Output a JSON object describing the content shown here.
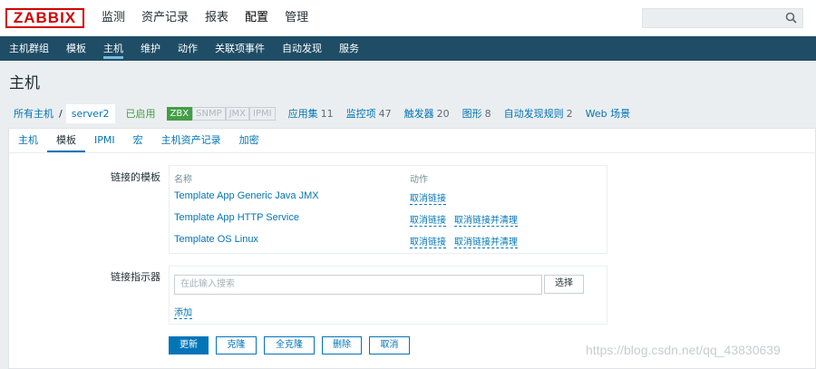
{
  "logo": "ZABBIX",
  "top_menu": [
    "监测",
    "资产记录",
    "报表",
    "配置",
    "管理"
  ],
  "top_menu_active": "配置",
  "search": {
    "value": "",
    "icon": "search-icon"
  },
  "sub_menu": [
    "主机群组",
    "模板",
    "主机",
    "维护",
    "动作",
    "关联项事件",
    "自动发现",
    "服务"
  ],
  "sub_menu_active": "主机",
  "page_title": "主机",
  "breadcrumb": {
    "all_hosts": "所有主机",
    "separator": "/",
    "current": "server2"
  },
  "host_status": "已启用",
  "availability": [
    {
      "label": "ZBX",
      "active": true
    },
    {
      "label": "SNMP",
      "active": false
    },
    {
      "label": "JMX",
      "active": false
    },
    {
      "label": "IPMI",
      "active": false
    }
  ],
  "host_links": [
    {
      "label": "应用集",
      "count": "11"
    },
    {
      "label": "监控项",
      "count": "47"
    },
    {
      "label": "触发器",
      "count": "20"
    },
    {
      "label": "图形",
      "count": "8"
    },
    {
      "label": "自动发现规则",
      "count": "2"
    },
    {
      "label": "Web 场景",
      "count": ""
    }
  ],
  "tabs": [
    "主机",
    "模板",
    "IPMI",
    "宏",
    "主机资产记录",
    "加密"
  ],
  "tabs_active": "模板",
  "linked_templates": {
    "label": "链接的模板",
    "col_name": "名称",
    "col_action": "动作",
    "rows": [
      {
        "name": "Template App Generic Java JMX",
        "actions": [
          "取消链接"
        ]
      },
      {
        "name": "Template App HTTP Service",
        "actions": [
          "取消链接",
          "取消链接并清理"
        ]
      },
      {
        "name": "Template OS Linux",
        "actions": [
          "取消链接",
          "取消链接并清理"
        ]
      }
    ]
  },
  "link_new": {
    "label": "链接指示器",
    "placeholder": "在此输入搜索",
    "select_label": "选择",
    "add_label": "添加"
  },
  "buttons": {
    "update": "更新",
    "clone": "克隆",
    "full_clone": "全克隆",
    "delete": "删除",
    "cancel": "取消"
  },
  "watermark": "https://blog.csdn.net/qq_43830639",
  "colors": {
    "header_bg": "#1f4d66",
    "link": "#0275b8",
    "enabled": "#429e47",
    "logo": "#d40000"
  }
}
